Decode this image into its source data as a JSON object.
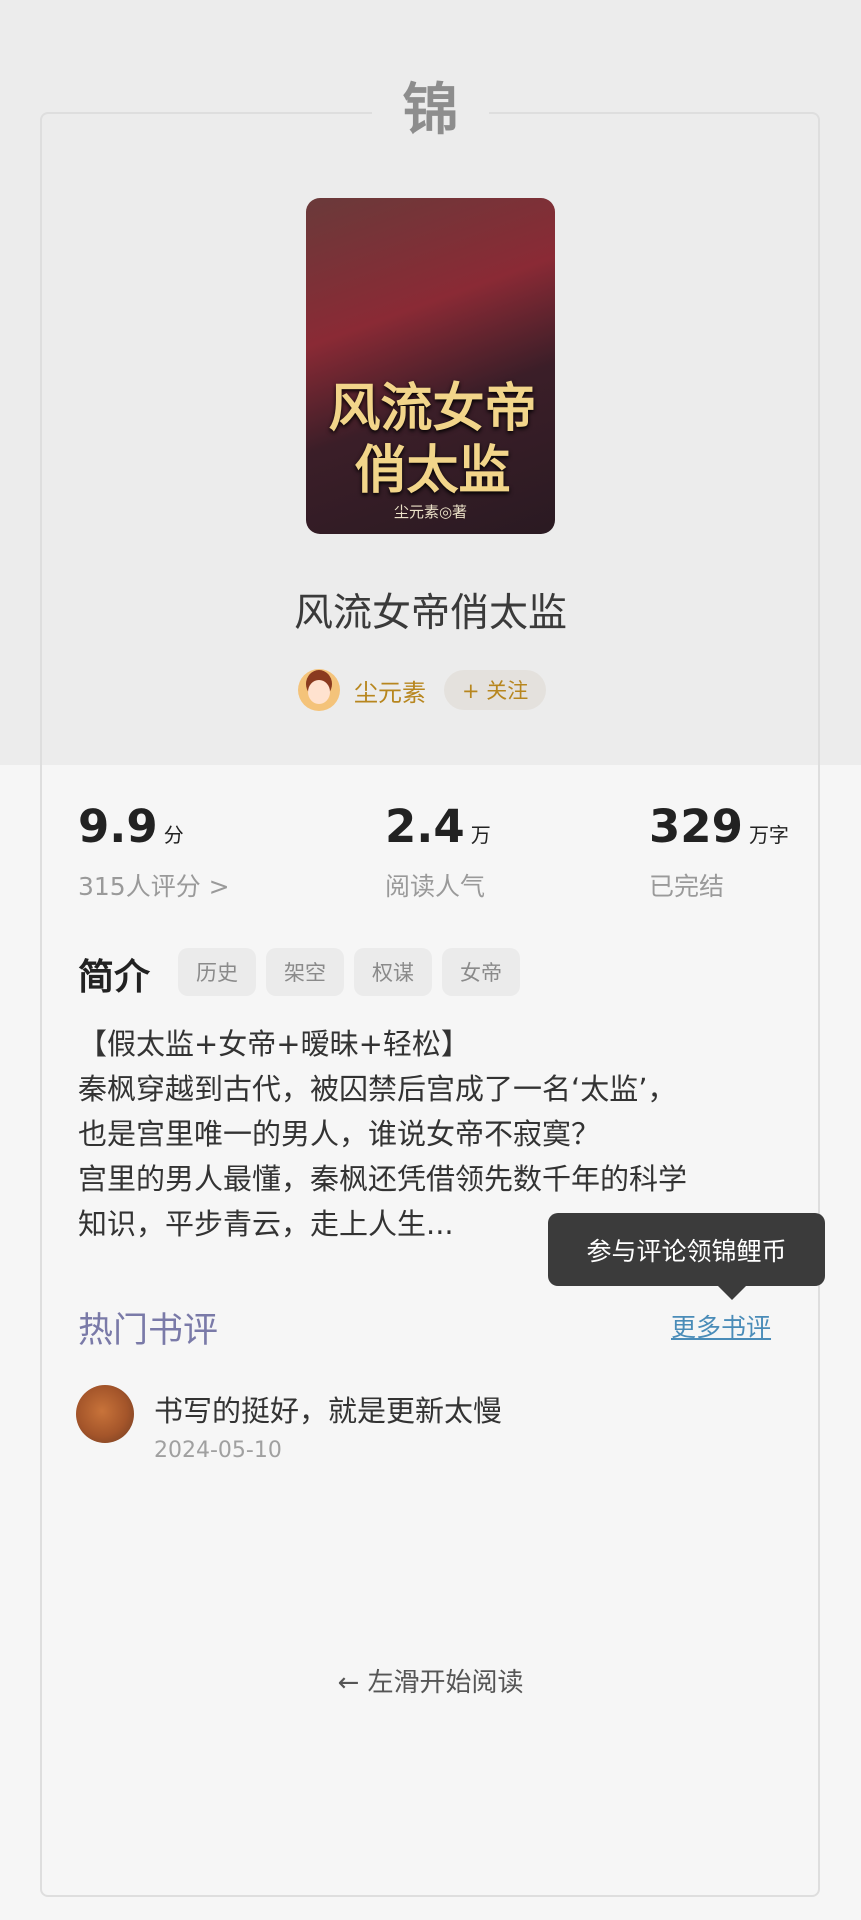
{
  "logo": {
    "glyph": "锦"
  },
  "book": {
    "title": "风流女帝俏太监",
    "cover": {
      "title_line1": "风流女帝",
      "title_line2": "俏太监",
      "author_mark": "尘元素◎著"
    },
    "author": "尘元素",
    "follow_label": "+ 关注"
  },
  "stats": {
    "rating": {
      "value": "9.9",
      "unit": "分",
      "label": "315人评分 >"
    },
    "popularity": {
      "value": "2.4",
      "unit": "万",
      "label": "阅读人气"
    },
    "words": {
      "value": "329",
      "unit": "万字",
      "label": "已完结"
    }
  },
  "intro": {
    "heading": "简介",
    "tags": [
      "历史",
      "架空",
      "权谋",
      "女帝"
    ],
    "lines": [
      "【假太监+女帝+暧昧+轻松】",
      "秦枫穿越到古代，被囚禁后宫成了一名‘太监’，",
      "也是宫里唯一的男人，谁说女帝不寂寞？",
      "宫里的男人最懂，秦枫还凭借领先数千年的科学",
      "知识，平步青云，走上人生..."
    ]
  },
  "tooltip": {
    "text": "参与评论领锦鲤币"
  },
  "reviews": {
    "heading": "热门书评",
    "more_label": "更多书评",
    "items": [
      {
        "text": "书写的挺好，就是更新太慢",
        "date": "2024-05-10"
      }
    ]
  },
  "footer": {
    "hint": "← 左滑开始阅读"
  }
}
